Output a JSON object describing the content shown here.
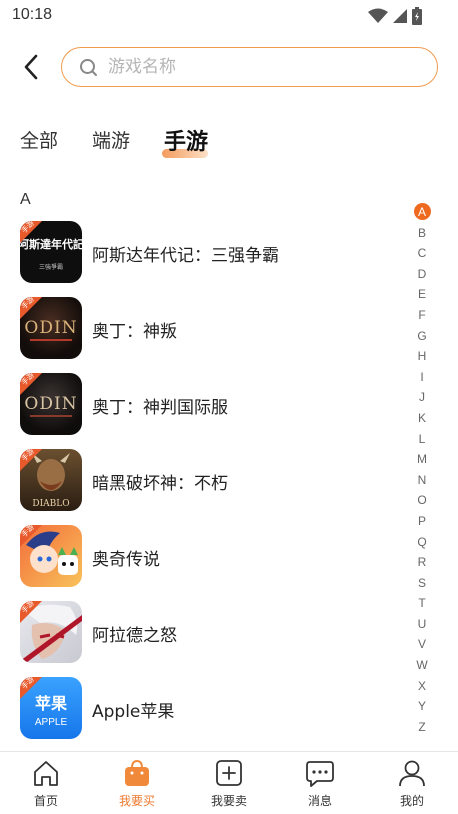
{
  "status_bar": {
    "time": "10:18"
  },
  "search": {
    "placeholder": "游戏名称",
    "value": ""
  },
  "tabs": [
    {
      "label": "全部",
      "active": false
    },
    {
      "label": "端游",
      "active": false
    },
    {
      "label": "手游",
      "active": true
    }
  ],
  "section": {
    "letter": "A"
  },
  "games": [
    {
      "name": "阿斯达年代记：三强争霸",
      "icon": "asda-chronicles-icon",
      "icon_text": "阿斯達年代記",
      "icon_subtext": "三強爭霸",
      "badge": "手游"
    },
    {
      "name": "奥丁：神叛",
      "icon": "odin-valhalla-rising-icon",
      "icon_text": "ODIN",
      "badge": "手游"
    },
    {
      "name": "奥丁：神判国际服",
      "icon": "odin-global-icon",
      "icon_text": "ODIN",
      "badge": "手游"
    },
    {
      "name": "暗黑破坏神：不朽",
      "icon": "diablo-immortal-icon",
      "icon_text": "DIABLO",
      "badge": "手游"
    },
    {
      "name": "奥奇传说",
      "icon": "aoqi-legend-icon",
      "badge": "手游"
    },
    {
      "name": "阿拉德之怒",
      "icon": "arad-wrath-icon",
      "badge": "手游"
    },
    {
      "name": "Apple苹果",
      "icon": "apple-recharge-icon",
      "icon_text": "苹果",
      "icon_subtext": "APPLE",
      "badge": "手游"
    }
  ],
  "alphabet_index": [
    "A",
    "B",
    "C",
    "D",
    "E",
    "F",
    "G",
    "H",
    "I",
    "J",
    "K",
    "L",
    "M",
    "N",
    "O",
    "P",
    "Q",
    "R",
    "S",
    "T",
    "U",
    "V",
    "W",
    "X",
    "Y",
    "Z"
  ],
  "alphabet_active": "A",
  "bottom_nav": [
    {
      "label": "首页",
      "icon": "home-icon",
      "active": false
    },
    {
      "label": "我要买",
      "icon": "shopping-bag-icon",
      "active": true
    },
    {
      "label": "我要卖",
      "icon": "plus-square-icon",
      "active": false
    },
    {
      "label": "消息",
      "icon": "message-bubble-icon",
      "active": false
    },
    {
      "label": "我的",
      "icon": "user-icon",
      "active": false
    }
  ],
  "colors": {
    "accent": "#ee6a1f",
    "search_border": "#f29a4e",
    "active_nav": "#ee7a2f"
  }
}
